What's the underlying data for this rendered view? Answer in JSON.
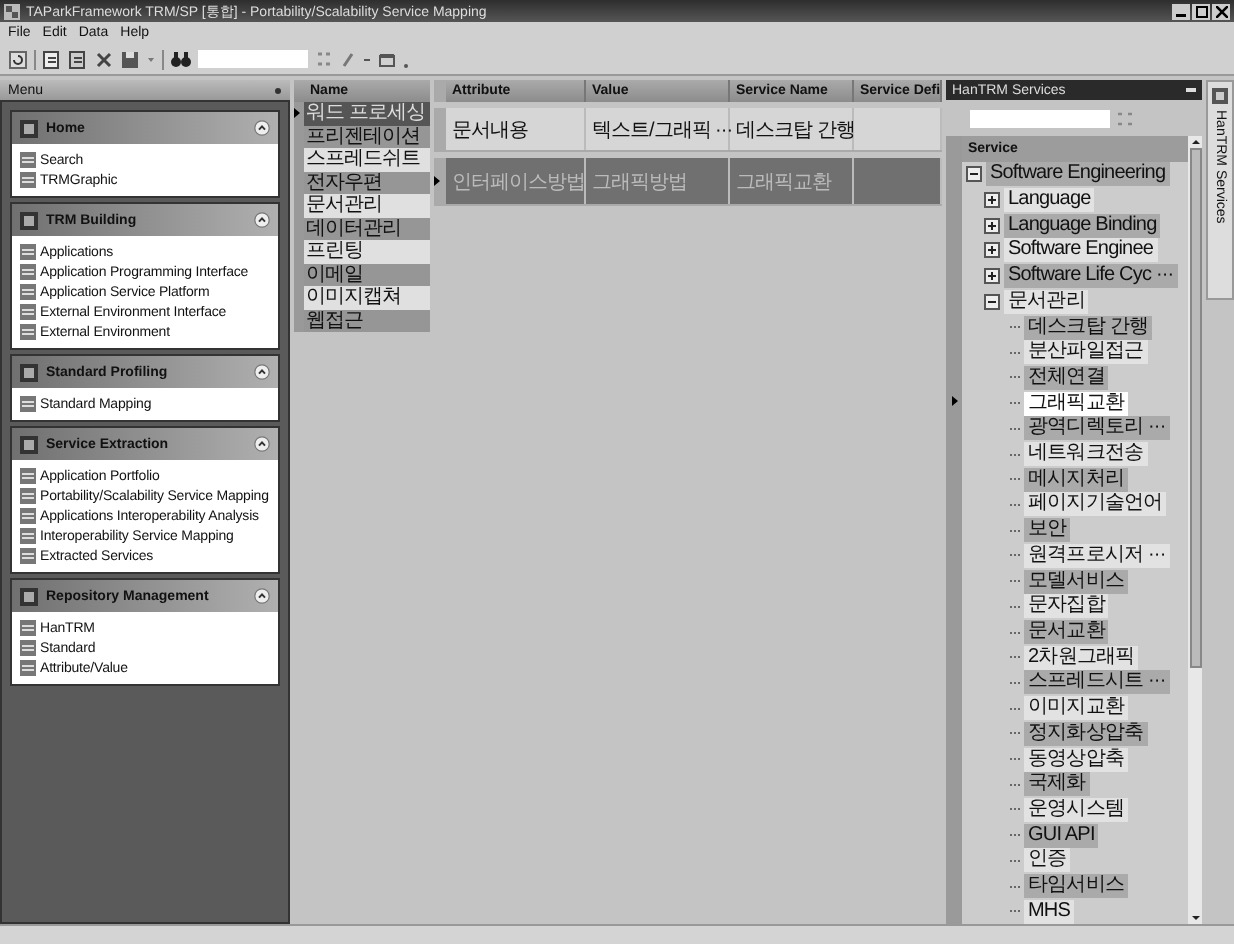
{
  "window": {
    "title": "TAParkFramework TRM/SP [통합] - Portability/Scalability Service Mapping"
  },
  "menu_bar": [
    "File",
    "Edit",
    "Data",
    "Help"
  ],
  "menu_panel": {
    "title": "Menu",
    "groups": [
      {
        "title": "Home",
        "items": [
          "Search",
          "TRMGraphic"
        ]
      },
      {
        "title": "TRM Building",
        "items": [
          "Applications",
          "Application Programming Interface",
          "Application Service Platform",
          "External Environment Interface",
          "External Environment"
        ]
      },
      {
        "title": "Standard Profiling",
        "items": [
          "Standard Mapping"
        ]
      },
      {
        "title": "Service Extraction",
        "items": [
          "Application Portfolio",
          "Portability/Scalability Service Mapping",
          "Applications Interoperability Analysis",
          "Interoperability Service Mapping",
          "Extracted Services"
        ]
      },
      {
        "title": "Repository Management",
        "items": [
          "HanTRM",
          "Standard",
          "Attribute/Value"
        ]
      }
    ]
  },
  "name_list": {
    "header": "Name",
    "rows": [
      {
        "name": "워드 프로세싱",
        "selected": true
      },
      {
        "name": "프리젠테이션",
        "selected": false
      },
      {
        "name": "스프레드쉬트",
        "selected": false
      },
      {
        "name": "전자우편",
        "selected": false
      },
      {
        "name": "문서관리",
        "selected": false
      },
      {
        "name": "데이터관리",
        "selected": false
      },
      {
        "name": "프린팅",
        "selected": false
      },
      {
        "name": "이메일",
        "selected": false
      },
      {
        "name": "이미지캡쳐",
        "selected": false
      },
      {
        "name": "웹접근",
        "selected": false
      }
    ]
  },
  "table": {
    "columns": [
      "Attribute",
      "Value",
      "Service Name",
      "Service Defi"
    ],
    "rows": [
      {
        "cells": [
          "문서내용",
          "텍스트/그래픽 ···",
          "데스크탑 간행",
          ""
        ],
        "selected": false
      },
      {
        "cells": [
          "인터페이스방법",
          "그래픽방법",
          "그래픽교환",
          ""
        ],
        "selected": true
      }
    ]
  },
  "services_panel": {
    "title": "HanTRM Services",
    "header": "Service",
    "tree": [
      {
        "label": "Software Engineering",
        "expanded": true,
        "selected": false,
        "children": [
          {
            "label": "Language",
            "expanded": false,
            "selected": false
          },
          {
            "label": "Language Binding",
            "expanded": false,
            "selected": false
          },
          {
            "label": "Software Enginee",
            "expanded": false,
            "selected": false
          },
          {
            "label": "Software Life Cyc ···",
            "expanded": false,
            "selected": false
          },
          {
            "label": "문서관리",
            "expanded": true,
            "selected": false,
            "children": [
              {
                "label": "데스크탑 간행",
                "selected": false
              },
              {
                "label": "분산파일접근",
                "selected": false
              },
              {
                "label": "전체연결",
                "selected": false
              },
              {
                "label": "그래픽교환",
                "selected": true
              },
              {
                "label": "광역디렉토리 ···",
                "selected": false
              },
              {
                "label": "네트워크전송",
                "selected": false
              },
              {
                "label": "메시지처리",
                "selected": false
              },
              {
                "label": "페이지기술언어",
                "selected": false
              },
              {
                "label": "보안",
                "selected": false
              },
              {
                "label": "원격프로시저 ···",
                "selected": false
              },
              {
                "label": "모델서비스",
                "selected": false
              },
              {
                "label": "문자집합",
                "selected": false
              },
              {
                "label": "문서교환",
                "selected": false
              },
              {
                "label": "2차원그래픽",
                "selected": false
              },
              {
                "label": "스프레드시트 ···",
                "selected": false
              },
              {
                "label": "이미지교환",
                "selected": false
              },
              {
                "label": "정지화상압축",
                "selected": false
              },
              {
                "label": "동영상압축",
                "selected": false
              },
              {
                "label": "국제화",
                "selected": false
              },
              {
                "label": "운영시스템",
                "selected": false
              },
              {
                "label": "GUI API",
                "selected": false
              },
              {
                "label": "인증",
                "selected": false
              },
              {
                "label": "타임서비스",
                "selected": false
              },
              {
                "label": "MHS",
                "selected": false
              }
            ]
          }
        ]
      }
    ]
  },
  "side_tab": {
    "label": "HanTRM Services"
  }
}
